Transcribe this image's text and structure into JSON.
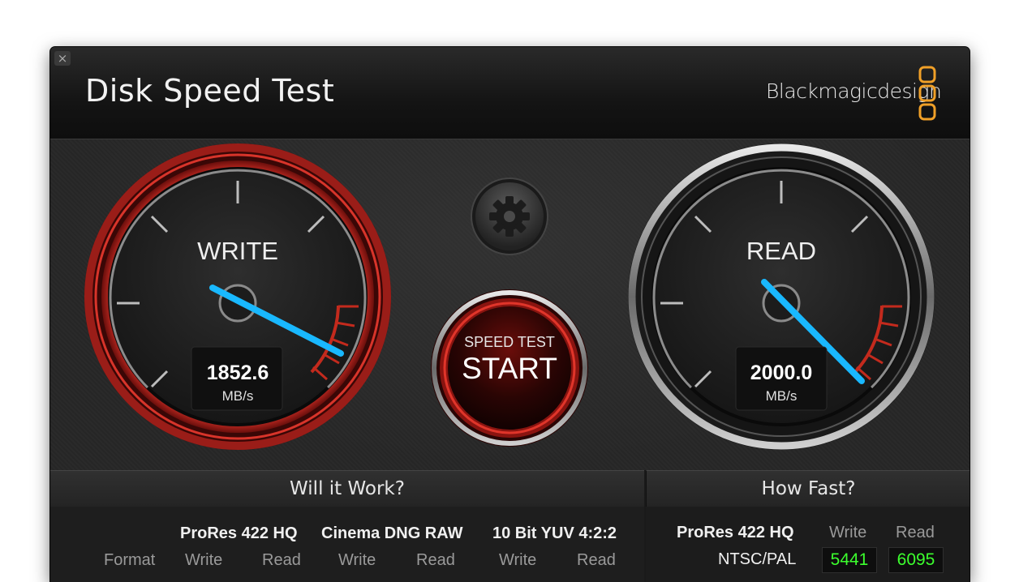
{
  "window": {
    "title": "Disk Speed Test",
    "brand": "Blackmagicdesign",
    "close_glyph": "×"
  },
  "gauges": {
    "write": {
      "label": "WRITE",
      "value": "1852.6",
      "unit": "MB/s",
      "accent": "#c0201c",
      "needle_color": "#19b8ff"
    },
    "read": {
      "label": "READ",
      "value": "2000.0",
      "unit": "MB/s",
      "accent": "#8a8a8a",
      "needle_color": "#19b8ff"
    }
  },
  "controls": {
    "settings_icon": "gear-icon",
    "start_caption": "SPEED TEST",
    "start_label": "START"
  },
  "will_it_work": {
    "title": "Will it Work?",
    "format_label": "Format",
    "formats": [
      {
        "name": "ProRes 422 HQ",
        "write": "Write",
        "read": "Read"
      },
      {
        "name": "Cinema DNG RAW",
        "write": "Write",
        "read": "Read"
      },
      {
        "name": "10 Bit YUV 4:2:2",
        "write": "Write",
        "read": "Read"
      }
    ]
  },
  "how_fast": {
    "title": "How Fast?",
    "format": "ProRes 422 HQ",
    "col_write": "Write",
    "col_read": "Read",
    "rows": [
      {
        "name": "NTSC/PAL",
        "write": "5441",
        "read": "6095"
      }
    ],
    "value_color": "#3cff2e"
  },
  "colors": {
    "brand_orange": "#f0a028",
    "start_red": "#c8201a"
  }
}
